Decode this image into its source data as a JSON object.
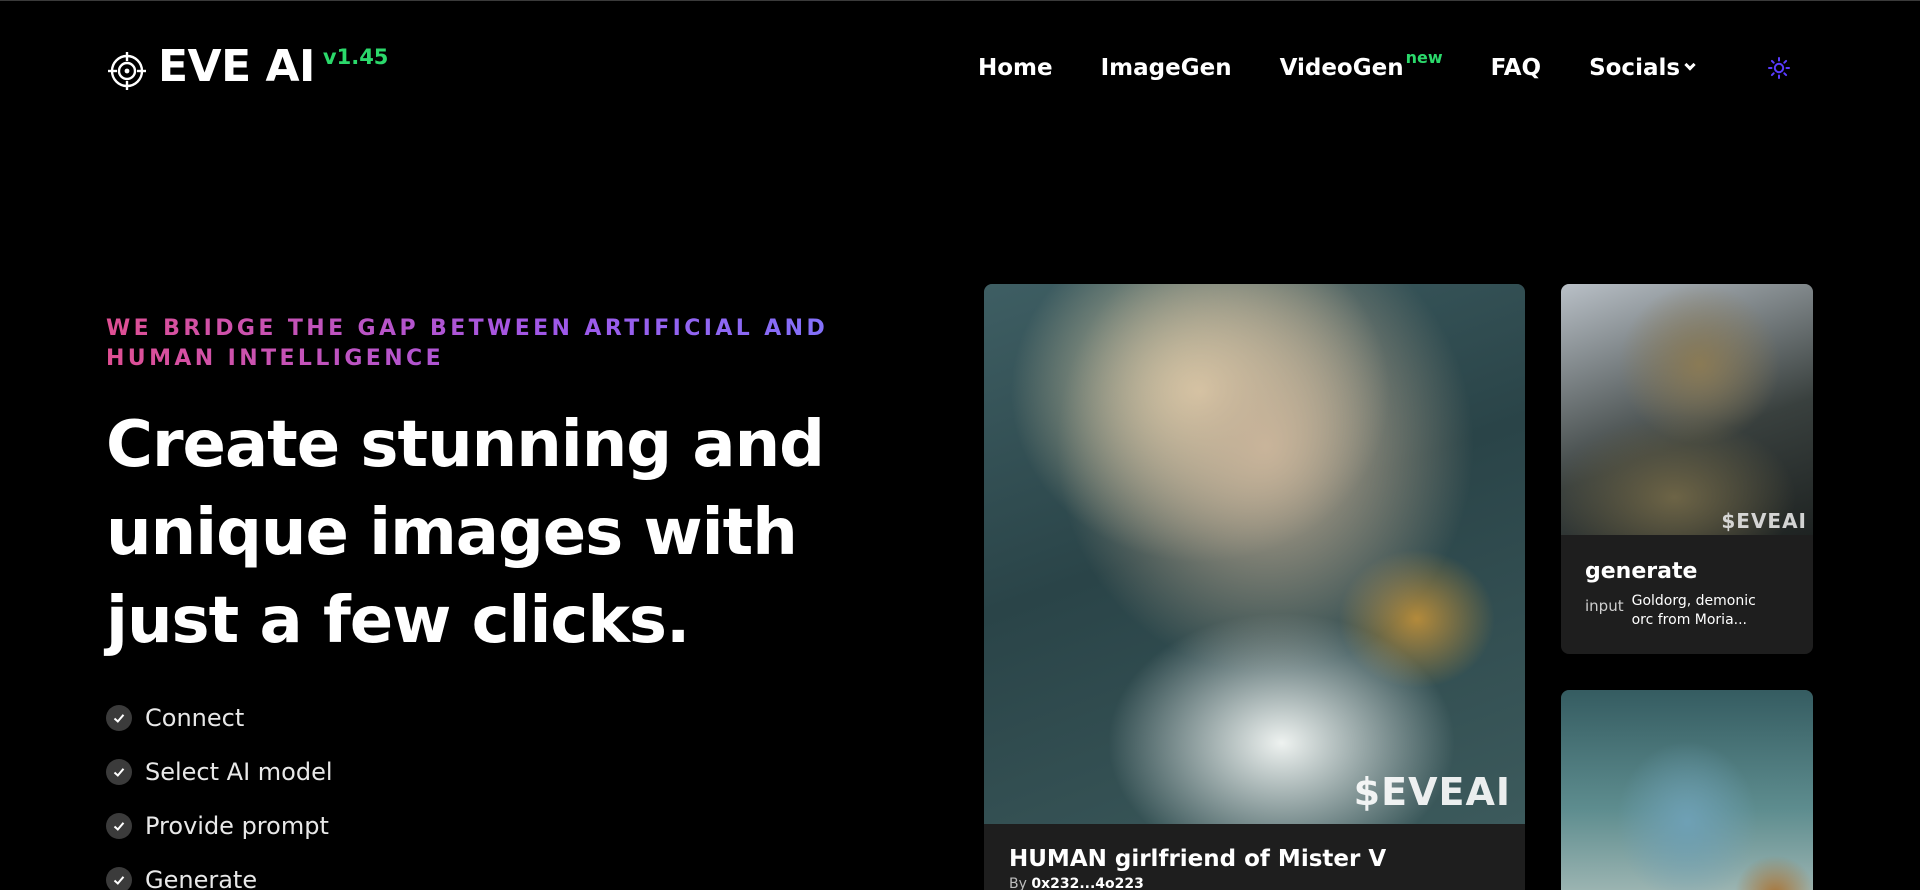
{
  "brand": {
    "name": "EVE AI",
    "version": "v1.45"
  },
  "nav": {
    "home": "Home",
    "imagegen": "ImageGen",
    "videogen": "VideoGen",
    "videogen_badge": "new",
    "faq": "FAQ",
    "socials": "Socials"
  },
  "hero": {
    "tagline": "WE BRIDGE THE GAP BETWEEN ARTIFICIAL AND HUMAN INTELLIGENCE",
    "headline": "Create stunning and unique images with just a few clicks.",
    "steps": [
      "Connect",
      "Select AI model",
      "Provide prompt",
      "Generate"
    ]
  },
  "gallery": {
    "main": {
      "watermark": "$EVEAI",
      "title": "HUMAN girlfriend of Mister V",
      "by_label": "By",
      "author": "0x232...4o223"
    },
    "small_1": {
      "watermark": "$EVEAI",
      "title": "generate",
      "input_label": "input",
      "input_value": "Goldorg, demonic orc from Moria..."
    }
  },
  "colors": {
    "accent_green": "#2bd96b",
    "tagline_gradient": [
      "#e04f93",
      "#a057e8",
      "#7b78ff"
    ],
    "card_bg": "#1e1e1e",
    "theme_icon": "#5a3cff"
  },
  "icons": {
    "logo": "target-crosshair-icon",
    "theme": "sun-icon",
    "step": "check-circle-icon",
    "dropdown": "chevron-down-icon"
  }
}
